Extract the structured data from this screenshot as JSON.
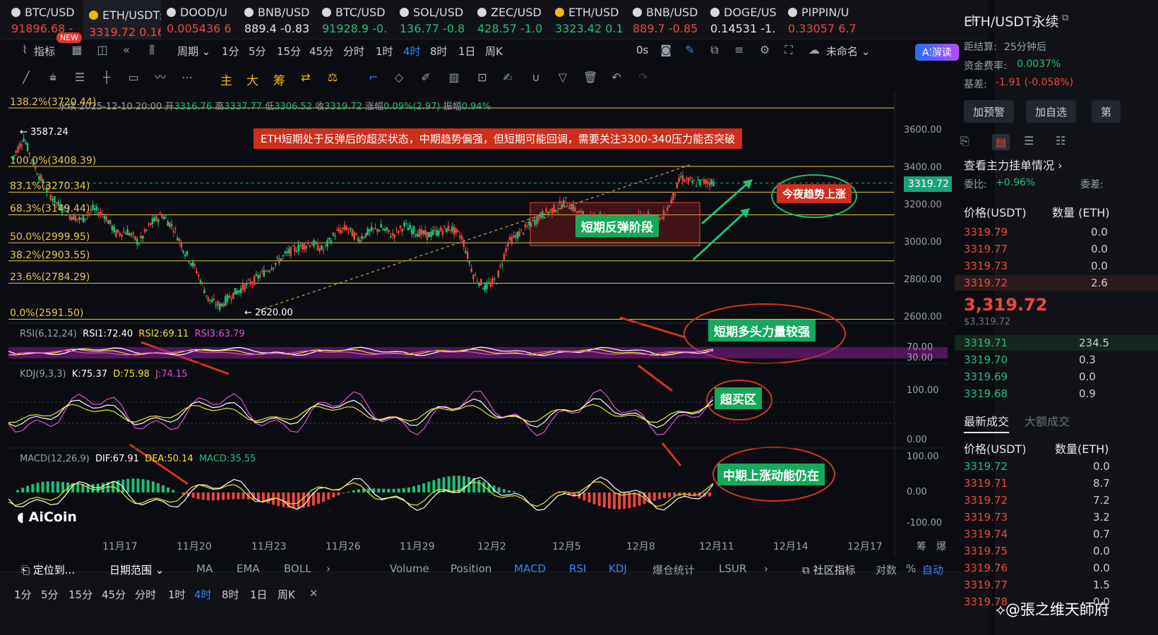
{
  "tabs": [
    {
      "name": "BTC/USD",
      "price": "91896.68",
      "chg": "-",
      "dir": "red"
    },
    {
      "name": "ETH/USDT永续",
      "price": "3319.72",
      "chg": "0.16%",
      "dir": "red"
    },
    {
      "name": "DOOD/U",
      "price": "0.005436",
      "chg": "6",
      "dir": "red"
    },
    {
      "name": "BNB/USD",
      "price": "889.4",
      "chg": "-0.83",
      "dir": "wht"
    },
    {
      "name": "BTC/USD",
      "price": "91928.9",
      "chg": "-0.",
      "dir": "green"
    },
    {
      "name": "SOL/USD",
      "price": "136.77",
      "chg": "-0.8",
      "dir": "green"
    },
    {
      "name": "ZEC/USD",
      "price": "428.57",
      "chg": "-1.0",
      "dir": "green"
    },
    {
      "name": "ETH/USD",
      "price": "3323.42",
      "chg": "0.1",
      "dir": "green"
    },
    {
      "name": "BNB/USD",
      "price": "889.7",
      "chg": "-0.85",
      "dir": "red"
    },
    {
      "name": "DOGE/US",
      "price": "0.14531",
      "chg": "-1.",
      "dir": "wht"
    },
    {
      "name": "PIPPIN/U",
      "price": "0.33057",
      "chg": "6.7",
      "dir": "red"
    }
  ],
  "new_badge": "NEW",
  "toolbar": {
    "indicators": "指标",
    "period": "周期",
    "intervals": [
      "1分",
      "5分",
      "15分",
      "45分",
      "分时",
      "1时",
      "4时",
      "8时",
      "1日",
      "周K"
    ],
    "selected_interval": "4时",
    "countdown": "0s",
    "account": "未命名",
    "ai": "AI解读"
  },
  "drawbar": {
    "main": "主",
    "big": "大",
    "chip": "筹"
  },
  "ohlc": {
    "symbol": "永续",
    "date": "2025-12-10 20:00",
    "open_label": "开",
    "open": "3316.76",
    "high_label": "高",
    "high": "3337.77",
    "low_label": "低",
    "low": "3306.52",
    "close_label": "收",
    "close": "3319.72",
    "chg_label": "涨幅",
    "chg": "0.09%(2.97)",
    "amp_label": "振幅",
    "amp": "0.94%"
  },
  "fib": [
    {
      "label": "138.2%(3720.44)",
      "price": 3720.44
    },
    {
      "label": "100.0%(3408.39)",
      "price": 3408.39
    },
    {
      "label": "83.1%(3270.34)",
      "price": 3270.34
    },
    {
      "label": "68.3%(3149.44)",
      "price": 3149.44
    },
    {
      "label": "50.0%(2999.95)",
      "price": 2999.95
    },
    {
      "label": "38.2%(2903.55)",
      "price": 2903.55
    },
    {
      "label": "23.6%(2784.29)",
      "price": 2784.29
    },
    {
      "label": "0.0%(2591.50)",
      "price": 2591.5
    }
  ],
  "price_axis": [
    "3600.00",
    "3400.00",
    "3200.00",
    "3000.00",
    "2800.00",
    "2600.00"
  ],
  "current_price": "3319.72",
  "high_mark": "3587.24",
  "low_mark": "2620.00",
  "headline": "ETH短期处于反弹后的超买状态，中期趋势偏强，但短期可能回调，需要关注3300-340压力能否突破",
  "annotations": {
    "rebound": "短期反弹阶段",
    "tonight": "今夜趋势上涨",
    "bull": "短期多头力量较强",
    "overbought": "超买区",
    "macd": "中期上涨动能仍在"
  },
  "rsi": {
    "name": "RSI(6,12,24)",
    "r1": "RSI1:72.40",
    "r2": "RSI2:69.11",
    "r3": "RSI3:63.79",
    "levels": [
      "70.00",
      "30.00"
    ]
  },
  "kdj": {
    "name": "KDJ(9,3,3)",
    "k": "K:75.37",
    "d": "D:75.98",
    "j": "J:74.15",
    "levels": [
      "100.00",
      "0.00"
    ]
  },
  "macd": {
    "name": "MACD(12,26,9)",
    "dif": "DIF:67.91",
    "dea": "DEA:50.14",
    "m": "MACD:35.55",
    "levels": [
      "100.00",
      "0.00",
      "-100.00"
    ]
  },
  "x_axis": [
    "11月17",
    "11月20",
    "11月23",
    "11月26",
    "11月29",
    "12月2",
    "12月5",
    "12月8",
    "12月11",
    "12月14",
    "12月17"
  ],
  "x_right": [
    "筹",
    "爆"
  ],
  "brand": "AiCoin",
  "bottom": {
    "locate": "定位到...",
    "range": "日期范围",
    "indicators": [
      "MA",
      "EMA",
      "BOLL"
    ],
    "subs": [
      "Volume",
      "Position",
      "MACD",
      "RSI",
      "KDJ",
      "爆仓统计",
      "LSUR"
    ],
    "community": "社区指标",
    "log": "对数",
    "pct": "%",
    "auto": "自动",
    "intervals": [
      "1分",
      "5分",
      "15分",
      "45分",
      "分时",
      "1时",
      "4时",
      "8时",
      "1日",
      "周K"
    ]
  },
  "panel": {
    "title": "ETH/USDT永续",
    "settle_label": "距结算:",
    "settle": "25分钟后",
    "funding_label": "资金费率:",
    "funding": "0.0037%",
    "basis_label": "基差:",
    "basis": "-1.91 (-0.058%)",
    "buttons": [
      "加预警",
      "加自选",
      "第"
    ],
    "depth_title": "查看主力挂单情况",
    "ratio_label": "委比:",
    "ratio": "+0.96%",
    "diff_label": "委差:",
    "col_price": "价格(USDT)",
    "col_qty": "数量 (ETH)",
    "asks": [
      [
        "3319.79",
        "0.0"
      ],
      [
        "3319.77",
        "0.0"
      ],
      [
        "3319.73",
        "0.0"
      ],
      [
        "3319.72",
        "2.6"
      ]
    ],
    "last": "3,319.72",
    "last_sub": "$3,319.72",
    "bids": [
      [
        "3319.71",
        "234.5"
      ],
      [
        "3319.70",
        "0.3"
      ],
      [
        "3319.69",
        "0.0"
      ],
      [
        "3319.68",
        "0.9"
      ]
    ],
    "trades_tab": "最新成交",
    "big_tab": "大额成交",
    "col_qty2": "数量(ETH)",
    "trades": [
      [
        "3319.72",
        "0.0",
        "green"
      ],
      [
        "3319.71",
        "8.7",
        "red"
      ],
      [
        "3319.72",
        "7.2",
        "red"
      ],
      [
        "3319.73",
        "3.2",
        "red"
      ],
      [
        "3319.74",
        "0.7",
        "red"
      ],
      [
        "3319.75",
        "0.0",
        "red"
      ],
      [
        "3319.76",
        "0.0",
        "red"
      ],
      [
        "3319.77",
        "1.5",
        "red"
      ],
      [
        "3319.78",
        "0.0",
        "red"
      ]
    ]
  },
  "watermark": "@張之维天師府"
}
